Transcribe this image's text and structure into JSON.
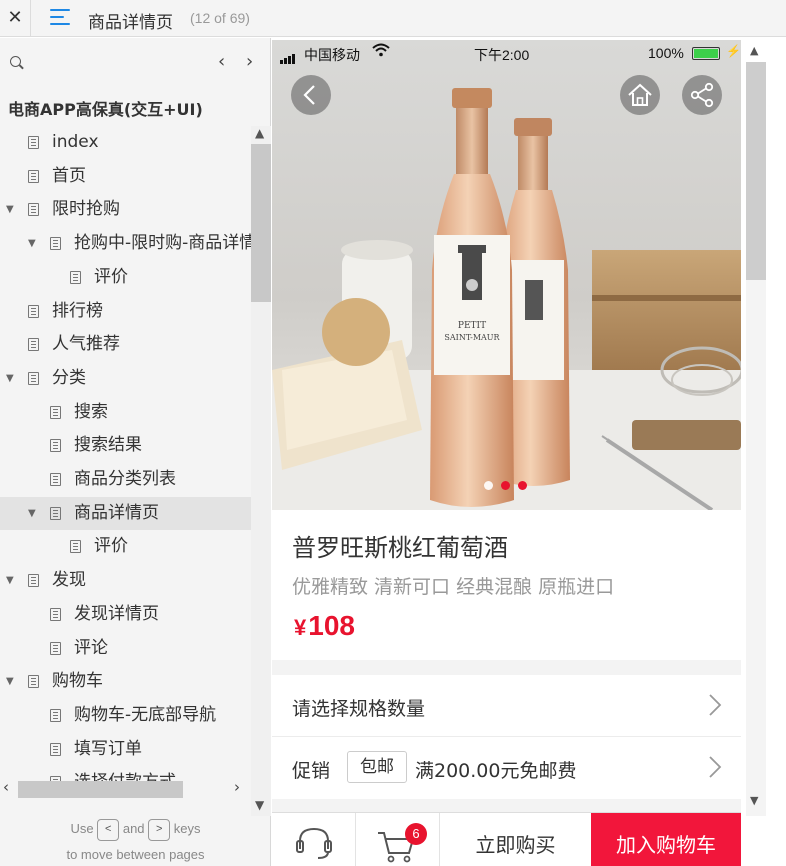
{
  "topbar": {
    "close_label": "✕",
    "title": "商品详情页",
    "page_count": "(12 of 69)"
  },
  "sidebar": {
    "project_title": "电商APP高保真(交互+UI)",
    "items": [
      {
        "label": "index",
        "level": 0,
        "caret": false
      },
      {
        "label": "首页",
        "level": 0,
        "caret": false
      },
      {
        "label": "限时抢购",
        "level": 0,
        "caret": true
      },
      {
        "label": "抢购中-限时购-商品详情",
        "level": 1,
        "caret": true
      },
      {
        "label": "评价",
        "level": 2,
        "caret": false
      },
      {
        "label": "排行榜",
        "level": 0,
        "caret": false
      },
      {
        "label": "人气推荐",
        "level": 0,
        "caret": false
      },
      {
        "label": "分类",
        "level": 0,
        "caret": true
      },
      {
        "label": "搜索",
        "level": 1,
        "caret": false
      },
      {
        "label": "搜索结果",
        "level": 1,
        "caret": false
      },
      {
        "label": "商品分类列表",
        "level": 1,
        "caret": false
      },
      {
        "label": "商品详情页",
        "level": 1,
        "caret": true,
        "active": true
      },
      {
        "label": "评价",
        "level": 2,
        "caret": false
      },
      {
        "label": "发现",
        "level": 0,
        "caret": true
      },
      {
        "label": "发现详情页",
        "level": 1,
        "caret": false
      },
      {
        "label": "评论",
        "level": 1,
        "caret": false
      },
      {
        "label": "购物车",
        "level": 0,
        "caret": true
      },
      {
        "label": "购物车-无底部导航",
        "level": 1,
        "caret": false
      },
      {
        "label": "填写订单",
        "level": 1,
        "caret": false
      },
      {
        "label": "选择付款方式",
        "level": 1,
        "caret": false
      }
    ],
    "hint_use": "Use",
    "hint_and": "and",
    "hint_keys": "keys",
    "hint_line2": "to move between pages",
    "key_prev": "<",
    "key_next": ">"
  },
  "phone": {
    "carrier": "中国移动",
    "time": "下午2:00",
    "battery": "100%",
    "product_name": "普罗旺斯桃红葡萄酒",
    "product_subtitle": "优雅精致 清新可口 经典混酿 原瓶进口",
    "price_symbol": "¥",
    "price": "108",
    "spec_label": "请选择规格数量",
    "promo_label": "促销",
    "promo_tag": "包邮",
    "promo_text": "满200.00元免邮费",
    "cart_badge": "6",
    "buy_now": "立即购买",
    "add_cart": "加入购物车",
    "bottle_label_1": "PETIT",
    "bottle_label_2": "SAINT-MAUR",
    "carousel_dots": 3,
    "carousel_active": 0
  },
  "colors": {
    "accent_red": "#e8132e",
    "add_cart_bg": "#f2163b",
    "menu_blue": "#1e88e5",
    "battery_green": "#3cd04a"
  }
}
